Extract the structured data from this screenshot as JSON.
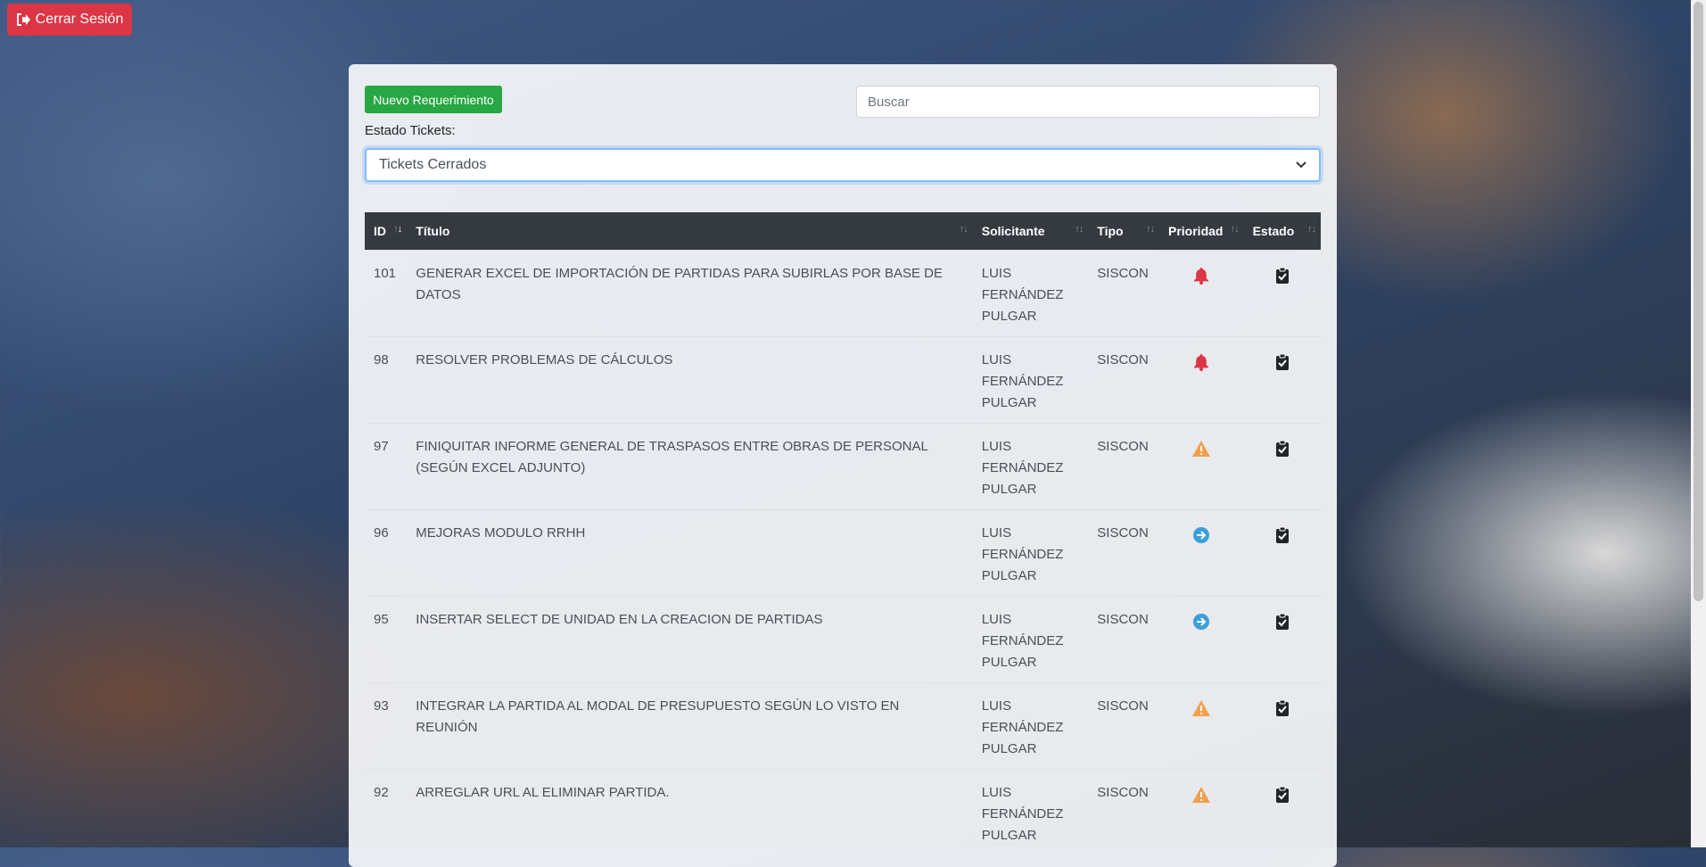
{
  "logout": {
    "label": "Cerrar Sesión",
    "icon": "sign-out-icon"
  },
  "toolbar": {
    "new_label": "Nuevo Requerimiento"
  },
  "search": {
    "placeholder": "Buscar"
  },
  "filter": {
    "label": "Estado Tickets:",
    "selected": "Tickets Cerrados"
  },
  "table": {
    "headers": {
      "id": "ID",
      "title": "Título",
      "requester": "Solicitante",
      "type": "Tipo",
      "priority": "Prioridad",
      "status": "Estado"
    },
    "rows": [
      {
        "id": "101",
        "title": "GENERAR EXCEL DE IMPORTACIÓN DE PARTIDAS PARA SUBIRLAS POR BASE DE DATOS",
        "requester": "LUIS FERNÁNDEZ PULGAR",
        "type": "SISCON",
        "priority": "bell",
        "status": "clipboard-check"
      },
      {
        "id": "98",
        "title": "RESOLVER PROBLEMAS DE CÁLCULOS",
        "requester": "LUIS FERNÁNDEZ PULGAR",
        "type": "SISCON",
        "priority": "bell",
        "status": "clipboard-check"
      },
      {
        "id": "97",
        "title": "FINIQUITAR INFORME GENERAL DE TRASPASOS ENTRE OBRAS DE PERSONAL (SEGÚN EXCEL ADJUNTO)",
        "requester": "LUIS FERNÁNDEZ PULGAR",
        "type": "SISCON",
        "priority": "warning",
        "status": "clipboard-check"
      },
      {
        "id": "96",
        "title": "MEJORAS MODULO RRHH",
        "requester": "LUIS FERNÁNDEZ PULGAR",
        "type": "SISCON",
        "priority": "arrow",
        "status": "clipboard-check"
      },
      {
        "id": "95",
        "title": "INSERTAR SELECT DE UNIDAD EN LA CREACION DE PARTIDAS",
        "requester": "LUIS FERNÁNDEZ PULGAR",
        "type": "SISCON",
        "priority": "arrow",
        "status": "clipboard-check"
      },
      {
        "id": "93",
        "title": "INTEGRAR LA PARTIDA AL MODAL DE PRESUPUESTO SEGÚN LO VISTO EN REUNIÓN",
        "requester": "LUIS FERNÁNDEZ PULGAR",
        "type": "SISCON",
        "priority": "warning",
        "status": "clipboard-check"
      },
      {
        "id": "92",
        "title": "ARREGLAR URL AL ELIMINAR PARTIDA.",
        "requester": "LUIS FERNÁNDEZ PULGAR",
        "type": "SISCON",
        "priority": "warning",
        "status": "clipboard-check"
      }
    ]
  },
  "colors": {
    "danger": "#dc3545",
    "success": "#28a745",
    "header_bg": "#343a40",
    "bell": "#dc3545",
    "warning": "#f0a04b",
    "arrow": "#3a9fd8"
  }
}
